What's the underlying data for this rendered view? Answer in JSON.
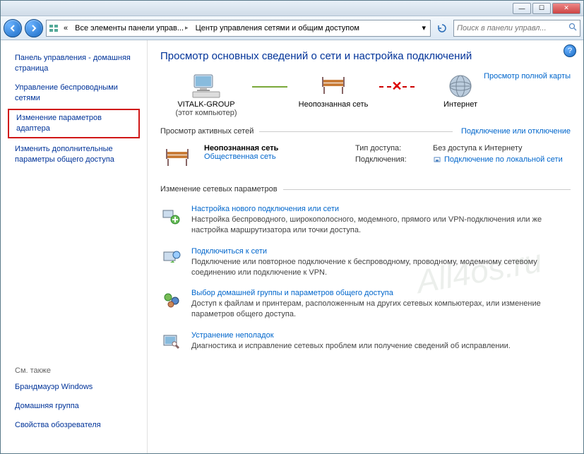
{
  "titlebar": {
    "min": "—",
    "max": "☐",
    "close": "✕"
  },
  "nav": {
    "breadcrumb_prefix": "«",
    "breadcrumb1": "Все элементы панели управ...",
    "breadcrumb2": "Центр управления сетями и общим доступом",
    "search_placeholder": "Поиск в панели управл..."
  },
  "sidebar": {
    "items": [
      "Панель управления - домашняя страница",
      "Управление беспроводными сетями",
      "Изменение параметров адаптера",
      "Изменить дополнительные параметры общего доступа"
    ],
    "see_also": "См. также",
    "footer": [
      "Брандмауэр Windows",
      "Домашняя группа",
      "Свойства обозревателя"
    ]
  },
  "content": {
    "title": "Просмотр основных сведений о сети и настройка подключений",
    "map_link": "Просмотр полной карты",
    "map": {
      "node1_name": "VITALK-GROUP",
      "node1_sub": "(этот компьютер)",
      "node2_name": "Неопознанная сеть",
      "node3_name": "Интернет"
    },
    "active_header": "Просмотр активных сетей",
    "active_link": "Подключение или отключение",
    "network": {
      "name": "Неопознанная сеть",
      "type": "Общественная сеть",
      "access_label": "Тип доступа:",
      "access_value": "Без доступа к Интернету",
      "conn_label": "Подключения:",
      "conn_value": "Подключение по локальной сети"
    },
    "params_header": "Изменение сетевых параметров",
    "tasks": [
      {
        "title": "Настройка нового подключения или сети",
        "desc": "Настройка беспроводного, широкополосного, модемного, прямого или VPN-подключения или же настройка маршрутизатора или точки доступа."
      },
      {
        "title": "Подключиться к сети",
        "desc": "Подключение или повторное подключение к беспроводному, проводному, модемному сетевому соединению или подключение к VPN."
      },
      {
        "title": "Выбор домашней группы и параметров общего доступа",
        "desc": "Доступ к файлам и принтерам, расположенным на других сетевых компьютерах, или изменение параметров общего доступа."
      },
      {
        "title": "Устранение неполадок",
        "desc": "Диагностика и исправление сетевых проблем или получение сведений об исправлении."
      }
    ]
  },
  "watermark": "All4os.ru"
}
